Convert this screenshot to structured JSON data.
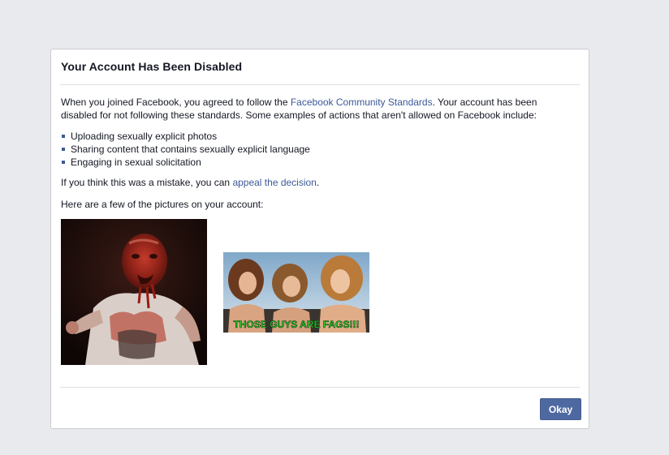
{
  "dialog": {
    "title": "Your Account Has Been Disabled",
    "intro_prefix": "When you joined Facebook, you agreed to follow the ",
    "intro_link": "Facebook Community Standards",
    "intro_suffix": ". Your account has been disabled for not following these standards. Some examples of actions that aren't allowed on Facebook include:",
    "rules": [
      "Uploading sexually explicit photos",
      "Sharing content that contains sexually explicit language",
      "Engaging in sexual solicitation"
    ],
    "mistake_prefix": "If you think this was a mistake, you can ",
    "mistake_link": "appeal the decision",
    "mistake_suffix": ".",
    "pictures_label": "Here are a few of the pictures on your account:",
    "photos": [
      {
        "name": "bloody-man-photo"
      },
      {
        "name": "three-women-photo",
        "caption": "THOSE GUYS ARE FAGS!!!"
      }
    ],
    "okay_label": "Okay"
  },
  "colors": {
    "page_background": "#e9eaed",
    "link": "#3b5998",
    "button": "#4e69a2",
    "caption_green": "#2cd12c"
  }
}
